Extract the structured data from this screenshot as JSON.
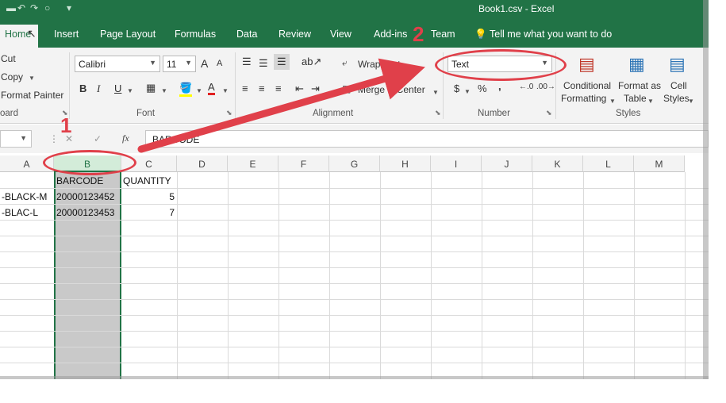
{
  "titlebar": {
    "window_title": "Book1.csv  -  Excel",
    "undo_icon": "undo-icon",
    "redo_icon": "redo-icon",
    "customize": "▾"
  },
  "tabs": [
    {
      "label": "Home",
      "active": true
    },
    {
      "label": "Insert"
    },
    {
      "label": "Page Layout"
    },
    {
      "label": "Formulas"
    },
    {
      "label": "Data"
    },
    {
      "label": "Review"
    },
    {
      "label": "View"
    },
    {
      "label": "Add-ins"
    },
    {
      "label": "Team"
    }
  ],
  "tell_me": "Tell me what you want to do",
  "clipboard": {
    "cut": "Cut",
    "copy": "Copy",
    "format_painter": "Format Painter",
    "group_label": "oard"
  },
  "font": {
    "name": "Calibri",
    "size": "11",
    "bold": "B",
    "italic": "I",
    "underline": "U",
    "font_color_letter": "A",
    "grow": "A",
    "shrink": "A",
    "group_label": "Font"
  },
  "alignment": {
    "wrap_text": "Wrap Text",
    "merge_center": "Merge & Center",
    "group_label": "Alignment"
  },
  "number": {
    "format": "Text",
    "currency": "$",
    "percent": "%",
    "comma": ",",
    "group_label": "Number"
  },
  "styles": {
    "conditional_line1": "Conditional",
    "conditional_line2": "Formatting",
    "format_as_line1": "Format as",
    "format_as_line2": "Table",
    "cell_line1": "Cell",
    "cell_line2": "Styles",
    "group_label": "Styles"
  },
  "formula_bar": {
    "fx": "fx",
    "cancel": "✕",
    "enter": "✓",
    "content": "BARCODE"
  },
  "columns": [
    "A",
    "B",
    "C",
    "D",
    "E",
    "F",
    "G",
    "H",
    "I",
    "J",
    "K",
    "L",
    "M"
  ],
  "rows": [
    {
      "a": "",
      "b": "BARCODE",
      "c": "QUANTITY"
    },
    {
      "a": "-BLACK-M",
      "b": "20000123452",
      "c": "5"
    },
    {
      "a": "-BLAC-L",
      "b": "20000123453",
      "c": "7"
    }
  ],
  "annotations": {
    "step1": "1",
    "step2": "2"
  },
  "colors": {
    "excel_green": "#217346",
    "annotation_red": "#e0404a",
    "ribbon_bg": "#f3f3f3"
  }
}
